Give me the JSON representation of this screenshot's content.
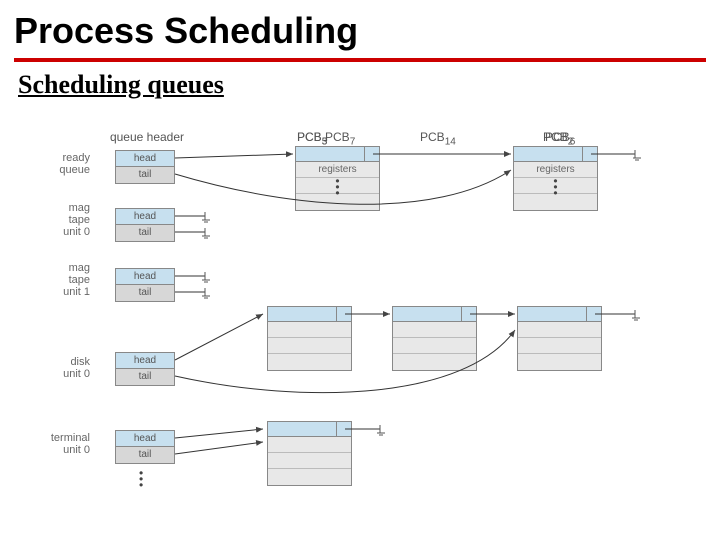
{
  "title": "Process Scheduling",
  "subtitle": "Scheduling queues",
  "headers": {
    "queue_header": "queue header",
    "pcb7": "PCB",
    "pcb7_sub": "7",
    "pcb2": "PCB",
    "pcb2_sub": "2",
    "pcb3": "PCB",
    "pcb3_sub": "3",
    "pcb14": "PCB",
    "pcb14_sub": "14",
    "pcb6": "PCB",
    "pcb6_sub": "6",
    "pcb5": "PCB",
    "pcb5_sub": "5"
  },
  "labels": {
    "ready": "ready\nqueue",
    "mag0": "mag\ntape\nunit 0",
    "mag1": "mag\ntape\nunit 1",
    "disk0": "disk\nunit 0",
    "term0": "terminal\nunit 0"
  },
  "cells": {
    "head": "head",
    "tail": "tail",
    "registers": "registers"
  }
}
